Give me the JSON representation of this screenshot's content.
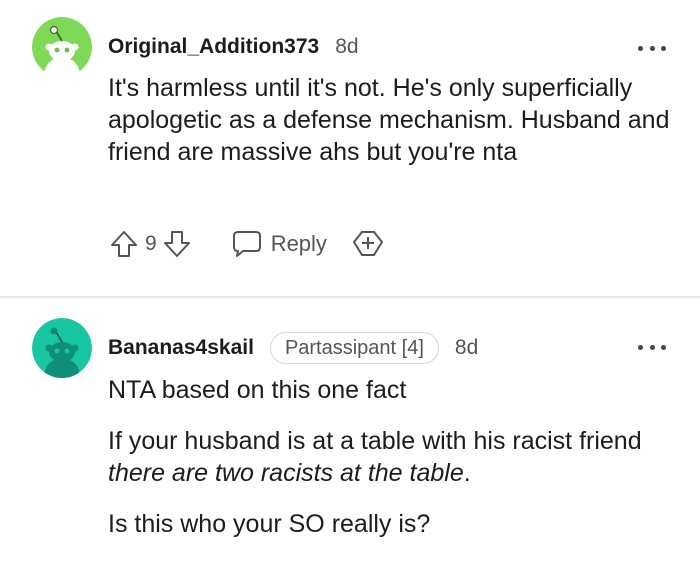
{
  "comments": [
    {
      "username": "Original_Addition373",
      "age": "8d",
      "body": "It's harmless until it's not. He's only superficially apologetic as a defense mechanism. Husband and friend are massive ahs but you're nta",
      "votes": "9",
      "reply_label": "Reply",
      "avatar_color": "#7ed957"
    },
    {
      "username": "Bananas4skail",
      "flair": "Partassipant [4]",
      "age": "8d",
      "paragraph1": "NTA based on this one fact",
      "paragraph2_plain": "If your husband is at a table with his racist friend ",
      "paragraph2_italic": "there are two racists at the table",
      "paragraph2_end": ".",
      "paragraph3": "Is this who your SO really is?",
      "avatar_color": "#18c6a4"
    }
  ],
  "icons": {
    "more": "more-options-icon",
    "upvote": "upvote-arrow-icon",
    "downvote": "downvote-arrow-icon",
    "reply": "speech-bubble-icon",
    "award": "award-plus-icon",
    "avatar": "snoo-avatar-icon"
  }
}
